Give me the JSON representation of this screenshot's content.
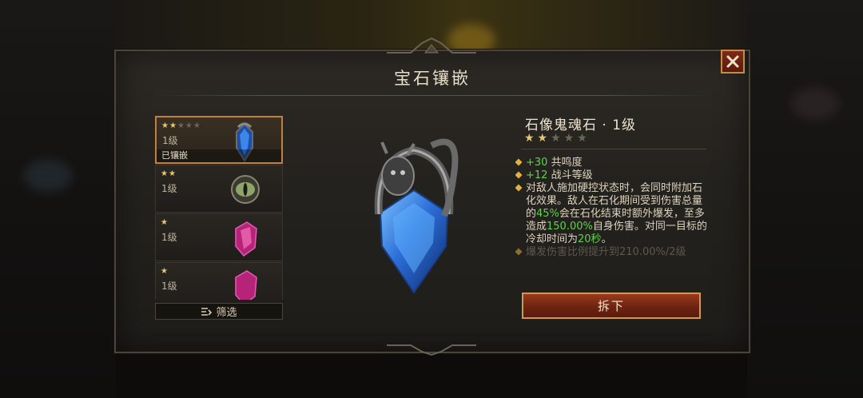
{
  "dialog": {
    "title": "宝石镶嵌",
    "close_label": "close"
  },
  "gem_list": [
    {
      "stars_filled": 2,
      "stars_total": 5,
      "level": "1级",
      "status": "已镶嵌",
      "gem": "blue-gargoyle-gem",
      "selected": true
    },
    {
      "stars_filled": 2,
      "stars_total": 2,
      "level": "1级",
      "status": "",
      "gem": "green-eye-gem",
      "selected": false
    },
    {
      "stars_filled": 1,
      "stars_total": 1,
      "level": "1级",
      "status": "",
      "gem": "pink-crystal-gem",
      "selected": false
    },
    {
      "stars_filled": 1,
      "stars_total": 1,
      "level": "1级",
      "status": "",
      "gem": "pink-crystal-gem",
      "selected": false
    }
  ],
  "filter": {
    "label": "筛选",
    "icon": "filter-icon"
  },
  "selected_gem": {
    "name": "石像鬼魂石 · 1级",
    "stars_filled": 2,
    "stars_total": 5,
    "effects": [
      {
        "parts": [
          {
            "text": "+30",
            "green": true
          },
          {
            "text": " 共鸣度",
            "green": false
          }
        ]
      },
      {
        "parts": [
          {
            "text": "+12",
            "green": true
          },
          {
            "text": " 战斗等级",
            "green": false
          }
        ]
      },
      {
        "parts": [
          {
            "text": "对敌人施加硬控状态时，会同时附加石化效果。敌人在石化期间受到伤害总量的",
            "green": false
          },
          {
            "text": "45%",
            "green": true
          },
          {
            "text": "会在石化结束时额外爆发，至多造成",
            "green": false
          },
          {
            "text": "150.00%",
            "green": true
          },
          {
            "text": "自身伤害。对同一目标的冷却时间为",
            "green": false
          },
          {
            "text": "20秒",
            "green": true
          },
          {
            "text": "。",
            "green": false
          }
        ]
      },
      {
        "parts": [
          {
            "text": "爆发伤害比例提升到210.00%/2级",
            "green": false
          }
        ],
        "faded": true
      }
    ]
  },
  "remove_button": {
    "label": "拆下"
  },
  "colors": {
    "accent_gold": "#e7c870",
    "highlight_green": "#5fd34a",
    "button_red": "#7d2a16",
    "selected_border": "#c2803a"
  }
}
